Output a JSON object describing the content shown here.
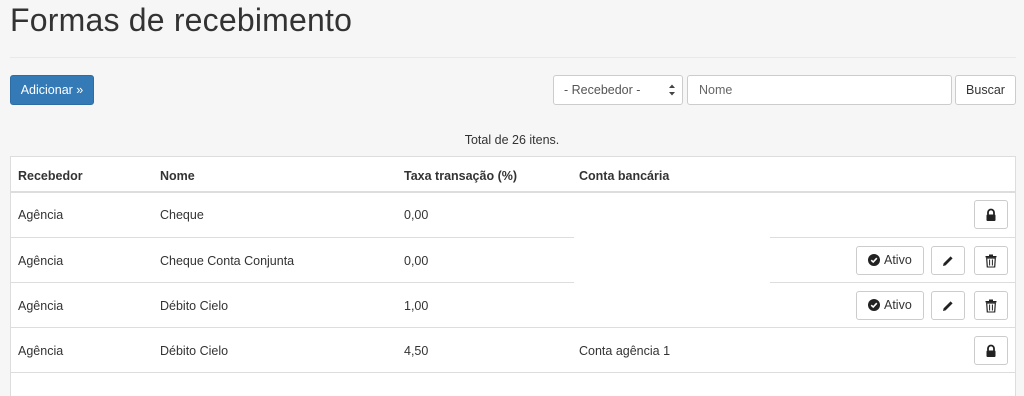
{
  "page": {
    "title": "Formas de recebimento"
  },
  "toolbar": {
    "add_label": "Adicionar »",
    "receiver_select_value": "- Recebedor -",
    "name_placeholder": "Nome",
    "search_label": "Buscar"
  },
  "summary": {
    "total_text": "Total de 26 itens."
  },
  "table": {
    "headers": [
      "Recebedor",
      "Nome",
      "Taxa transação (%)",
      "Conta bancária"
    ],
    "rows": [
      {
        "recebedor": "Agência",
        "nome": "Cheque",
        "taxa": "0,00",
        "conta": "",
        "ativo_label": "",
        "actions": [
          "lock-icon"
        ]
      },
      {
        "recebedor": "Agência",
        "nome": "Cheque Conta Conjunta",
        "taxa": "0,00",
        "conta": "",
        "ativo_label": "Ativo",
        "actions": [
          "check-circle-icon",
          "pencil-icon",
          "trash-icon"
        ]
      },
      {
        "recebedor": "Agência",
        "nome": "Débito Cielo",
        "taxa": "1,00",
        "conta": "",
        "ativo_label": "Ativo",
        "actions": [
          "check-circle-icon",
          "pencil-icon",
          "trash-icon"
        ]
      },
      {
        "recebedor": "Agência",
        "nome": "Débito Cielo",
        "taxa": "4,50",
        "conta": "Conta agência 1",
        "ativo_label": "",
        "actions": [
          "lock-icon"
        ]
      }
    ]
  },
  "colors": {
    "primary": "#337ab7",
    "background": "#f6f6f6",
    "border": "#dddddd"
  }
}
